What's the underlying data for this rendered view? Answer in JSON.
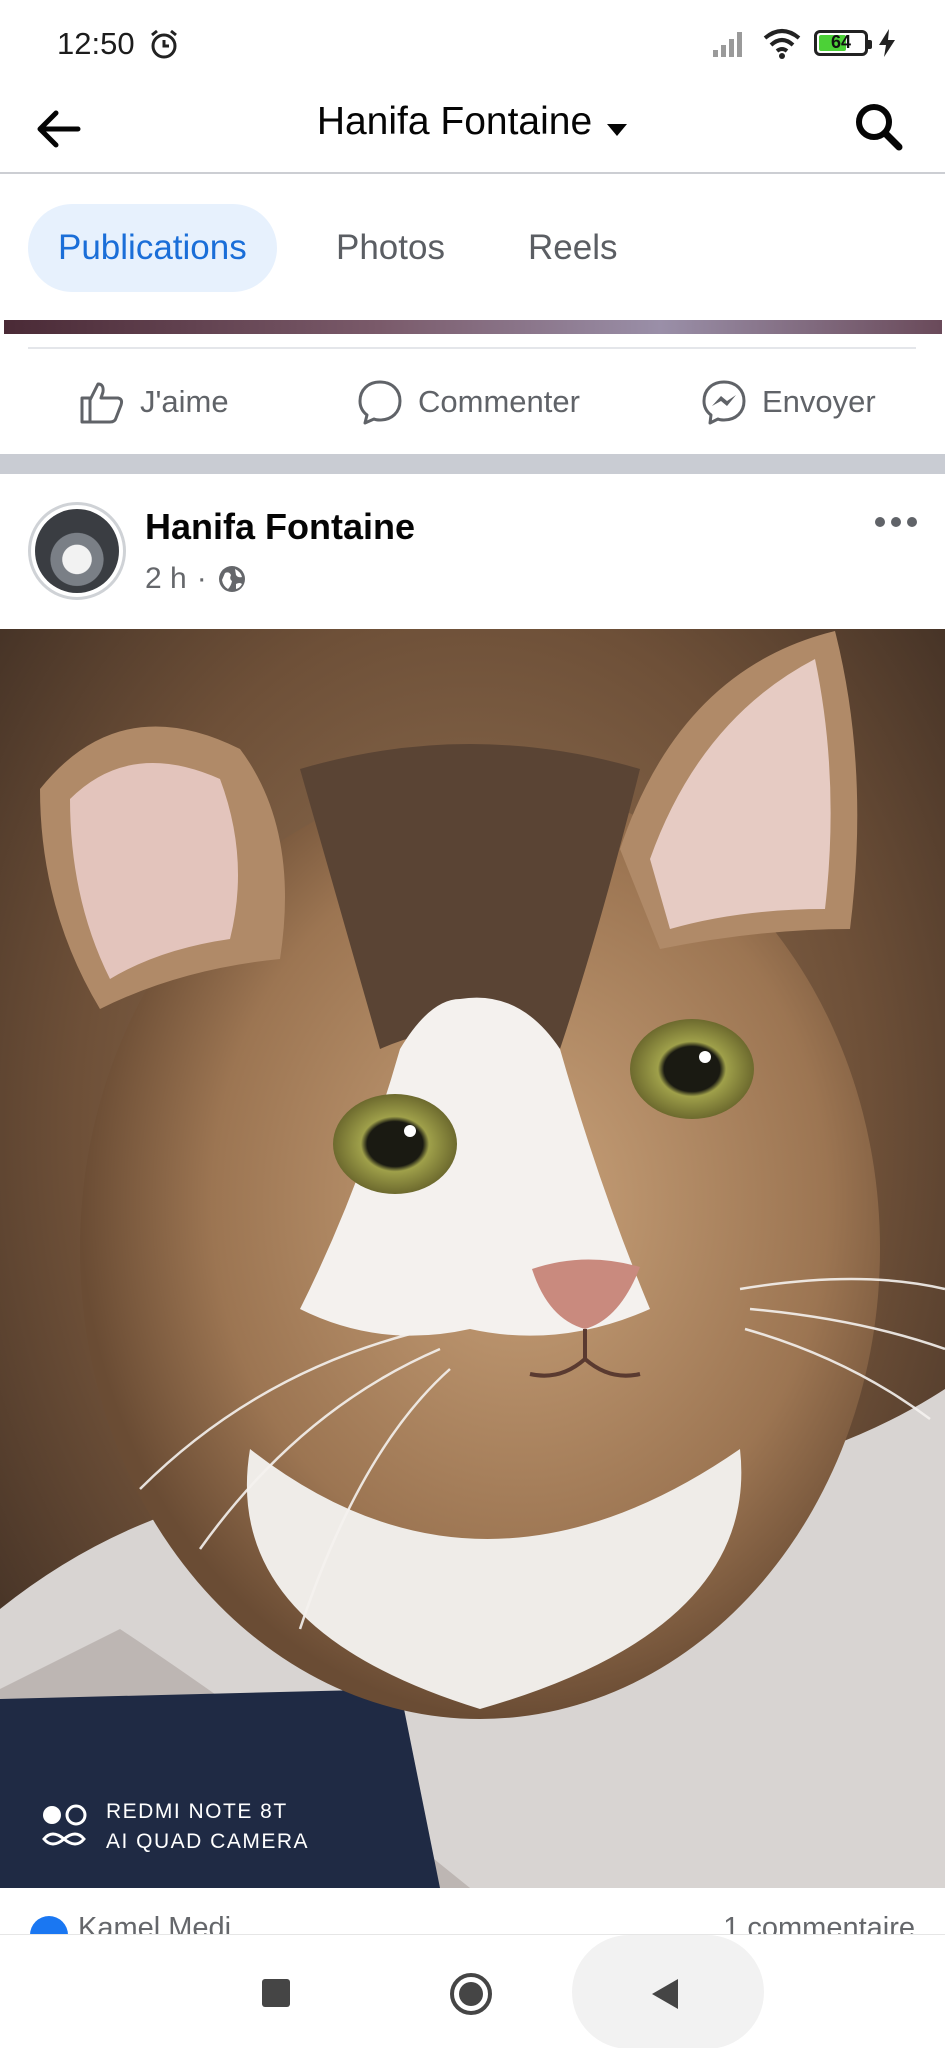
{
  "status_bar": {
    "time": "12:50",
    "battery_level": "64",
    "battery_fraction": 0.64,
    "icons": [
      "alarm-icon",
      "signal-icon",
      "wifi-icon",
      "battery-icon",
      "charging-bolt-icon"
    ]
  },
  "header": {
    "title": "Hanifa Fontaine",
    "icons": [
      "back-arrow-icon",
      "caret-down-icon",
      "search-icon"
    ]
  },
  "tabs": [
    {
      "label": "Publications",
      "active": true
    },
    {
      "label": "Photos",
      "active": false
    },
    {
      "label": "Reels",
      "active": false
    }
  ],
  "actions": {
    "like_label": "J'aime",
    "comment_label": "Commenter",
    "send_label": "Envoyer"
  },
  "post": {
    "author": "Hanifa Fontaine",
    "time": "2 h",
    "separator": "·",
    "watermark_line1": "REDMI NOTE 8T",
    "watermark_line2": "AI QUAD CAMERA",
    "reaction_name": "Kamel Medi",
    "comment_count": "1 commentaire"
  },
  "colors": {
    "accent": "#1a6ed8",
    "tab_active_bg": "#e7f1fd",
    "secondary_text": "#65676b",
    "section_gap": "#c9ccd3"
  }
}
